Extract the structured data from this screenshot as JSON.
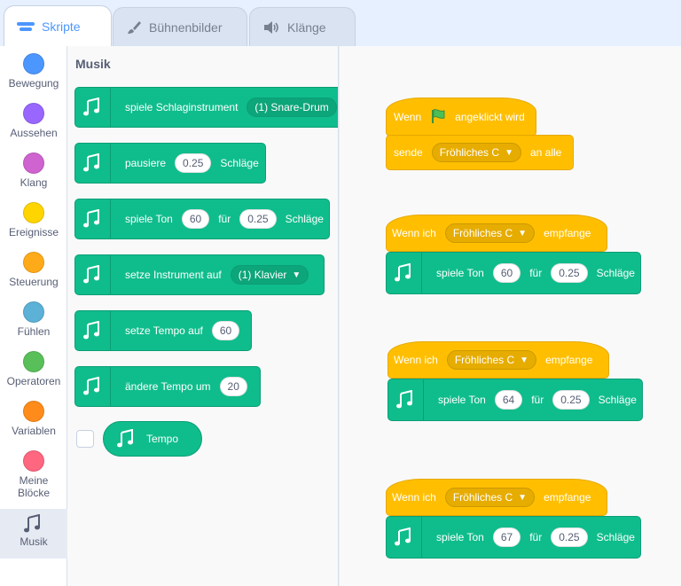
{
  "tabs": [
    {
      "label": "Skripte",
      "icon": "code-icon"
    },
    {
      "label": "Bühnenbilder",
      "icon": "brush-icon"
    },
    {
      "label": "Klänge",
      "icon": "speaker-icon"
    }
  ],
  "categories": [
    {
      "label": "Bewegung",
      "color": "#4c97ff"
    },
    {
      "label": "Aussehen",
      "color": "#9966ff"
    },
    {
      "label": "Klang",
      "color": "#cf63cf"
    },
    {
      "label": "Ereignisse",
      "color": "#ffd500"
    },
    {
      "label": "Steuerung",
      "color": "#ffab19"
    },
    {
      "label": "Fühlen",
      "color": "#5cb1d6"
    },
    {
      "label": "Operatoren",
      "color": "#59c059"
    },
    {
      "label": "Variablen",
      "color": "#ff8c1a"
    },
    {
      "label": "Meine Blöcke",
      "color": "#ff6680"
    },
    {
      "label": "Musik",
      "icon": "music-notes-icon"
    }
  ],
  "flyout": {
    "title": "Musik",
    "play_drum": {
      "text": "spiele Schlaginstrument",
      "value": "(1) Snare-Drum"
    },
    "rest": {
      "text": "pausiere",
      "value": "0.25",
      "unit": "Schläge"
    },
    "play_note": {
      "text": "spiele Ton",
      "note": "60",
      "mid": "für",
      "beats": "0.25",
      "unit": "Schläge"
    },
    "set_instrument": {
      "text": "setze Instrument auf",
      "value": "(1) Klavier"
    },
    "set_tempo": {
      "text": "setze Tempo auf",
      "value": "60"
    },
    "change_tempo": {
      "text": "ändere Tempo um",
      "value": "20"
    },
    "tempo_reporter": {
      "text": "Tempo"
    }
  },
  "scripts": {
    "s1": {
      "hat_pre": "Wenn",
      "hat_post": "angeklickt wird",
      "broadcast": "sende",
      "message": "Fröhliches C",
      "broadcast_post": "an alle"
    },
    "s2": {
      "hat_pre": "Wenn ich",
      "message": "Fröhliches C",
      "hat_post": "empfange",
      "play": "spiele Ton",
      "note": "60",
      "mid": "für",
      "beats": "0.25",
      "unit": "Schläge"
    },
    "s3": {
      "hat_pre": "Wenn ich",
      "message": "Fröhliches C",
      "hat_post": "empfange",
      "play": "spiele Ton",
      "note": "64",
      "mid": "für",
      "beats": "0.25",
      "unit": "Schläge"
    },
    "s4": {
      "hat_pre": "Wenn ich",
      "message": "Fröhliches C",
      "hat_post": "empfange",
      "play": "spiele Ton",
      "note": "67",
      "mid": "für",
      "beats": "0.25",
      "unit": "Schläge"
    }
  }
}
